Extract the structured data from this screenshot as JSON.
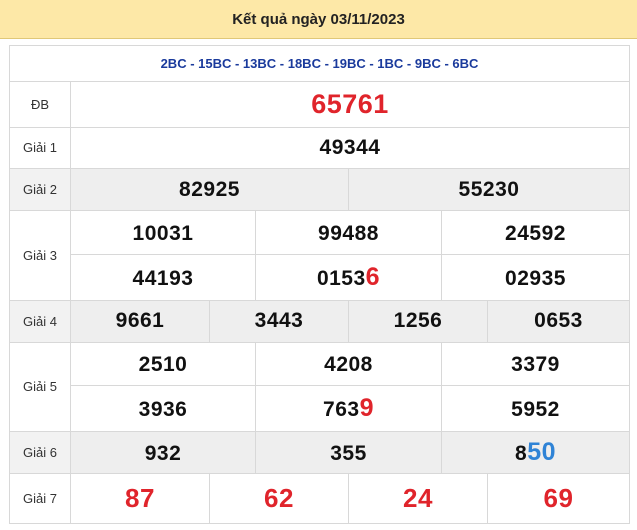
{
  "title": "Kết quả ngày 03/11/2023",
  "codes": "2BC - 15BC - 13BC - 18BC - 19BC - 1BC - 9BC - 6BC",
  "colors": {
    "header_bg": "#fde8a7",
    "code_blue": "#1a3a9c",
    "red": "#e0242b",
    "blue": "#2f83d6"
  },
  "labels": {
    "db": "ĐB",
    "g1": "Giải 1",
    "g2": "Giải 2",
    "g3": "Giải 3",
    "g4": "Giải 4",
    "g5": "Giải 5",
    "g6": "Giải 6",
    "g7": "Giải 7"
  },
  "db": "65761",
  "g1": "49344",
  "g2": [
    "82925",
    "55230"
  ],
  "g3": [
    {
      "main": "10031",
      "hl": ""
    },
    {
      "main": "99488",
      "hl": ""
    },
    {
      "main": "24592",
      "hl": ""
    },
    {
      "main": "44193",
      "hl": ""
    },
    {
      "main": "0153",
      "hl": "6"
    },
    {
      "main": "02935",
      "hl": ""
    }
  ],
  "g4": [
    "9661",
    "3443",
    "1256",
    "0653"
  ],
  "g5": [
    {
      "main": "2510",
      "hl": ""
    },
    {
      "main": "4208",
      "hl": ""
    },
    {
      "main": "3379",
      "hl": ""
    },
    {
      "main": "3936",
      "hl": ""
    },
    {
      "main": "763",
      "hl": "9"
    },
    {
      "main": "5952",
      "hl": ""
    }
  ],
  "g6": [
    {
      "main": "932",
      "hl": ""
    },
    {
      "main": "355",
      "hl": ""
    },
    {
      "main": "8",
      "hl": "50"
    }
  ],
  "g7": [
    "87",
    "62",
    "24",
    "69"
  ]
}
